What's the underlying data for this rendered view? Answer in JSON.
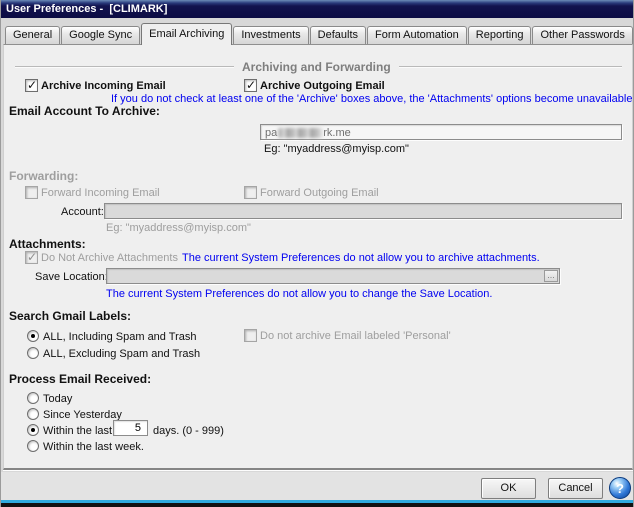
{
  "window": {
    "title": "User Preferences -  [CLIMARK]"
  },
  "tabs": {
    "active": "Email Archiving",
    "items": [
      {
        "label": "General"
      },
      {
        "label": "Google Sync"
      },
      {
        "label": "Email Archiving"
      },
      {
        "label": "Investments"
      },
      {
        "label": "Defaults"
      },
      {
        "label": "Form Automation"
      },
      {
        "label": "Reporting"
      },
      {
        "label": "Other Passwords"
      }
    ]
  },
  "archiving": {
    "section_title": "Archiving and Forwarding",
    "archive_incoming": {
      "label": "Archive Incoming Email",
      "checked": true,
      "enabled": true
    },
    "archive_outgoing": {
      "label": "Archive Outgoing Email",
      "checked": true,
      "enabled": true
    },
    "note": "If you do not check at least one of the 'Archive' boxes above, the 'Attachments' options become unavailable.",
    "account_label": "Email Account To Archive:",
    "account_value_prefix": "pa",
    "account_value_suffix": "rk.me",
    "account_value_redacted": true,
    "account_hint": "Eg: \"myaddress@myisp.com\""
  },
  "forwarding": {
    "section_label": "Forwarding:",
    "forward_incoming": {
      "label": "Forward Incoming Email",
      "checked": false,
      "enabled": false
    },
    "forward_outgoing": {
      "label": "Forward Outgoing Email",
      "checked": false,
      "enabled": false
    },
    "account_label": "Account:",
    "account_value": "",
    "account_hint": "Eg: \"myaddress@myisp.com\""
  },
  "attachments": {
    "section_label": "Attachments:",
    "do_not_archive": {
      "label": "Do Not Archive Attachments",
      "checked": true,
      "enabled": false
    },
    "do_not_archive_note": "The current System Preferences do not allow you to archive attachments.",
    "save_location_label": "Save Location:",
    "save_location_value": "",
    "browse_button": "...",
    "save_location_note": "The current System Preferences do not allow you to change the Save Location."
  },
  "gmail_labels": {
    "section_label": "Search Gmail Labels:",
    "option_all_including": {
      "label": "ALL, Including Spam and Trash",
      "selected": true
    },
    "option_all_excluding": {
      "label": "ALL, Excluding Spam and Trash",
      "selected": false
    },
    "personal_checkbox": {
      "label": "Do not archive Email labeled 'Personal'",
      "checked": false,
      "enabled": false
    }
  },
  "process_email": {
    "section_label": "Process Email Received:",
    "option_today": {
      "label": "Today",
      "selected": false
    },
    "option_since_yesterday": {
      "label": "Since Yesterday",
      "selected": false
    },
    "option_within_days": {
      "label_before": "Within the last",
      "days_value": "5",
      "label_after": "days. (0 - 999)",
      "selected": true
    },
    "option_within_week": {
      "label": "Within the last week.",
      "selected": false
    }
  },
  "footer": {
    "ok_label": "OK",
    "cancel_label": "Cancel",
    "help_icon": "?"
  }
}
